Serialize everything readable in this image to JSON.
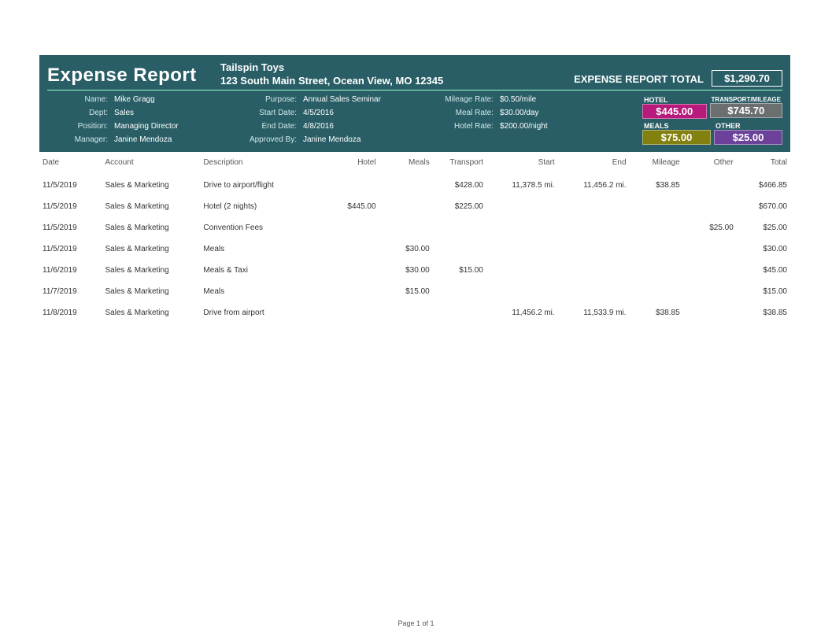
{
  "title": "Expense Report",
  "company": "Tailspin Toys",
  "address": "123 South Main Street, Ocean View, MO  12345",
  "grand_total_label": "EXPENSE REPORT TOTAL",
  "grand_total": "$1,290.70",
  "labels": {
    "name": "Name:",
    "dept": "Dept:",
    "position": "Position:",
    "manager": "Manager:",
    "purpose": "Purpose:",
    "start_date": "Start Date:",
    "end_date": "End Date:",
    "approved_by": "Approved By:",
    "mileage_rate": "Mileage Rate:",
    "meal_rate": "Meal Rate:",
    "hotel_rate": "Hotel Rate:"
  },
  "info": {
    "name": "Mike Gragg",
    "dept": "Sales",
    "position": "Managing Director",
    "manager": "Janine Mendoza",
    "purpose": "Annual Sales Seminar",
    "start_date": "4/5/2016",
    "end_date": "4/8/2016",
    "approved_by": "Janine Mendoza",
    "mileage_rate": "$0.50/mile",
    "meal_rate": "$30.00/day",
    "hotel_rate": "$200.00/night"
  },
  "summary": {
    "hotel_label": "HOTEL",
    "hotel": "$445.00",
    "trans_label": "TRANSPORT/MILEAGE",
    "trans": "$745.70",
    "meals_label": "MEALS",
    "meals": "$75.00",
    "other_label": "OTHER",
    "other": "$25.00"
  },
  "columns": {
    "date": "Date",
    "account": "Account",
    "description": "Description",
    "hotel": "Hotel",
    "meals": "Meals",
    "transport": "Transport",
    "start": "Start",
    "end": "End",
    "mileage": "Mileage",
    "other": "Other",
    "total": "Total"
  },
  "rows": [
    {
      "date": "11/5/2019",
      "account": "Sales & Marketing",
      "description": "Drive to airport/flight",
      "hotel": "",
      "meals": "",
      "transport": "$428.00",
      "start": "11,378.5 mi.",
      "end": "11,456.2 mi.",
      "mileage": "$38.85",
      "other": "",
      "total": "$466.85"
    },
    {
      "date": "11/5/2019",
      "account": "Sales & Marketing",
      "description": "Hotel (2 nights)",
      "hotel": "$445.00",
      "meals": "",
      "transport": "$225.00",
      "start": "",
      "end": "",
      "mileage": "",
      "other": "",
      "total": "$670.00"
    },
    {
      "date": "11/5/2019",
      "account": "Sales & Marketing",
      "description": "Convention Fees",
      "hotel": "",
      "meals": "",
      "transport": "",
      "start": "",
      "end": "",
      "mileage": "",
      "other": "$25.00",
      "total": "$25.00"
    },
    {
      "date": "11/5/2019",
      "account": "Sales & Marketing",
      "description": "Meals",
      "hotel": "",
      "meals": "$30.00",
      "transport": "",
      "start": "",
      "end": "",
      "mileage": "",
      "other": "",
      "total": "$30.00"
    },
    {
      "date": "11/6/2019",
      "account": "Sales & Marketing",
      "description": "Meals & Taxi",
      "hotel": "",
      "meals": "$30.00",
      "transport": "$15.00",
      "start": "",
      "end": "",
      "mileage": "",
      "other": "",
      "total": "$45.00"
    },
    {
      "date": "11/7/2019",
      "account": "Sales & Marketing",
      "description": "Meals",
      "hotel": "",
      "meals": "$15.00",
      "transport": "",
      "start": "",
      "end": "",
      "mileage": "",
      "other": "",
      "total": "$15.00"
    },
    {
      "date": "11/8/2019",
      "account": "Sales & Marketing",
      "description": "Drive from airport",
      "hotel": "",
      "meals": "",
      "transport": "",
      "start": "11,456.2 mi.",
      "end": "11,533.9 mi.",
      "mileage": "$38.85",
      "other": "",
      "total": "$38.85"
    }
  ],
  "footer": "Page 1 of 1"
}
